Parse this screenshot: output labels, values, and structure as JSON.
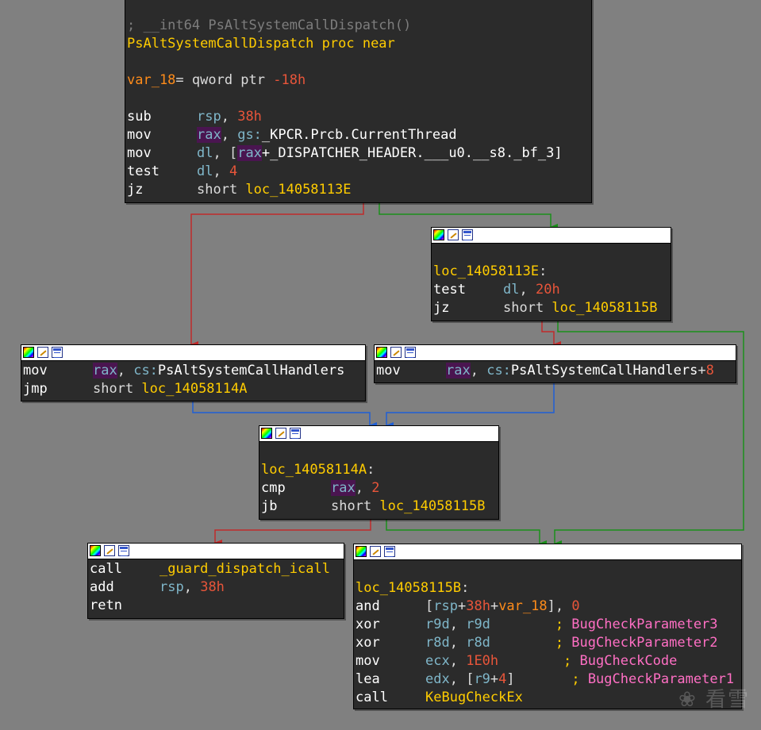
{
  "entry": {
    "comment": "; __int64 PsAltSystemCallDispatch()",
    "proc_name": "PsAltSystemCallDispatch",
    "proc_kw": "proc near",
    "var_name": "var_18",
    "var_eq": "= qword ptr ",
    "var_val": "-18h",
    "l1_m": "sub",
    "l1_reg": "rsp",
    "l1_sep": ", ",
    "l1_num": "38h",
    "l2_m": "mov",
    "l2_reg": "rax",
    "l2_sep": ", ",
    "l2_seg": "gs:",
    "l2_name": "_KPCR.Prcb.CurrentThread",
    "l3_m": "mov",
    "l3_reg": "dl",
    "l3_a": ", [",
    "l3_rax": "rax",
    "l3_b": "+_DISPATCHER_HEADER.___u0.__s8._bf_3]",
    "l4_m": "test",
    "l4_reg": "dl",
    "l4_sep": ", ",
    "l4_num": "4",
    "l5_m": "jz",
    "l5_kw": "short ",
    "l5_lbl": "loc_14058113E"
  },
  "n113e": {
    "label": "loc_14058113E",
    "colon": ":",
    "l1_m": "test",
    "l1_reg": "dl",
    "l1_sep": ", ",
    "l1_num": "20h",
    "l2_m": "jz",
    "l2_kw": "short ",
    "l2_lbl": "loc_14058115B"
  },
  "left_handler": {
    "l1_m": "mov",
    "l1_reg": "rax",
    "l1_sep": ", ",
    "l1_seg": "cs:",
    "l1_name": "PsAltSystemCallHandlers",
    "l2_m": "jmp",
    "l2_kw": "short ",
    "l2_lbl": "loc_14058114A"
  },
  "right_handler": {
    "l1_m": "mov",
    "l1_reg": "rax",
    "l1_sep": ", ",
    "l1_seg": "cs:",
    "l1_name": "PsAltSystemCallHandlers",
    "l1_plus": "+",
    "l1_num": "8"
  },
  "n114a": {
    "label": "loc_14058114A",
    "colon": ":",
    "l1_m": "cmp",
    "l1_reg": "rax",
    "l1_sep": ", ",
    "l1_num": "2",
    "l2_m": "jb",
    "l2_kw": "short ",
    "l2_lbl": "loc_14058115B"
  },
  "icall": {
    "l1_m": "call",
    "l1_lbl": "_guard_dispatch_icall",
    "l2_m": "add",
    "l2_reg": "rsp",
    "l2_sep": ", ",
    "l2_num": "38h",
    "l3_m": "retn"
  },
  "n115b": {
    "label": "loc_14058115B",
    "colon": ":",
    "l1_m": "and",
    "l1_a": "[",
    "l1_reg": "rsp",
    "l1_p1": "+",
    "l1_num": "38h",
    "l1_p2": "+",
    "l1_var": "var_18",
    "l1_b": "], ",
    "l1_num2": "0",
    "l2_m": "xor",
    "l2_reg": "r9d",
    "l2_sep": ", ",
    "l2_reg2": "r9d",
    "l2_pad": "        ",
    "l2_semi": "; ",
    "l2_cmt": "BugCheckParameter3",
    "l3_m": "xor",
    "l3_reg": "r8d",
    "l3_sep": ", ",
    "l3_reg2": "r8d",
    "l3_pad": "        ",
    "l3_semi": "; ",
    "l3_cmt": "BugCheckParameter2",
    "l4_m": "mov",
    "l4_reg": "ecx",
    "l4_sep": ", ",
    "l4_num": "1E0h",
    "l4_pad": "        ",
    "l4_semi": "; ",
    "l4_cmt": "BugCheckCode",
    "l5_m": "lea",
    "l5_reg": "edx",
    "l5_a": ", [",
    "l5_reg2": "r9",
    "l5_p": "+",
    "l5_num": "4",
    "l5_b": "]",
    "l5_pad": "       ",
    "l5_semi": "; ",
    "l5_cmt": "BugCheckParameter1",
    "l6_m": "call",
    "l6_lbl": "KeBugCheckEx"
  },
  "watermark": "❀ 看雪",
  "colors": {
    "background": "#808080",
    "node": "#2b2b2b",
    "edge_true": "#1a8f1a",
    "edge_false": "#c02a2a",
    "edge_uncond": "#1f5fd6"
  },
  "icons": [
    "graph-color-icon",
    "rename-icon",
    "list-view-icon"
  ]
}
